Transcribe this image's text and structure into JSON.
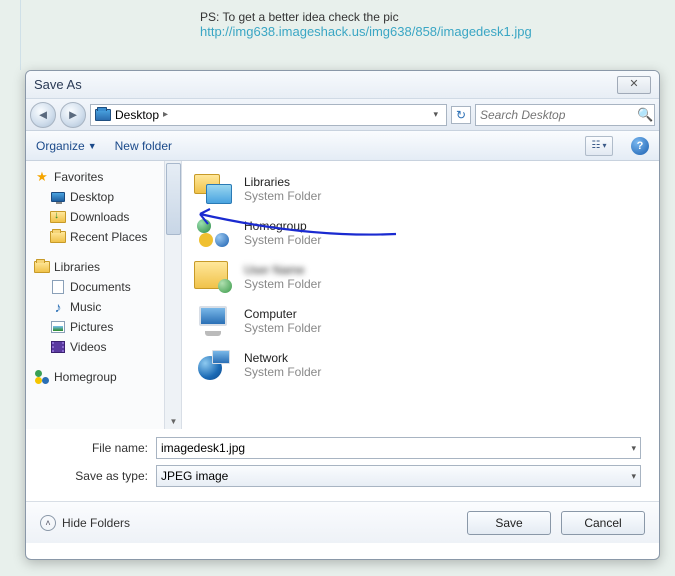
{
  "post": {
    "text": "PS: To get a better idea check the pic",
    "link": "http://img638.imageshack.us/img638/858/imagedesk1.jpg"
  },
  "dialog": {
    "title": "Save As",
    "breadcrumb": {
      "location": "Desktop"
    },
    "search": {
      "placeholder": "Search Desktop"
    },
    "toolbar": {
      "organize": "Organize",
      "new_folder": "New folder"
    },
    "sidebar": {
      "favorites": {
        "label": "Favorites",
        "items": [
          {
            "label": "Desktop"
          },
          {
            "label": "Downloads"
          },
          {
            "label": "Recent Places"
          }
        ]
      },
      "libraries": {
        "label": "Libraries",
        "items": [
          {
            "label": "Documents"
          },
          {
            "label": "Music"
          },
          {
            "label": "Pictures"
          },
          {
            "label": "Videos"
          }
        ]
      },
      "homegroup": {
        "label": "Homegroup"
      }
    },
    "content": {
      "items": [
        {
          "name": "Libraries",
          "sub": "System Folder"
        },
        {
          "name": "Homegroup",
          "sub": "System Folder"
        },
        {
          "name": "blurred",
          "sub": "System Folder"
        },
        {
          "name": "Computer",
          "sub": "System Folder"
        },
        {
          "name": "Network",
          "sub": "System Folder"
        }
      ]
    },
    "fields": {
      "filename_label": "File name:",
      "filename_value": "imagedesk1.jpg",
      "savetype_label": "Save as type:",
      "savetype_value": "JPEG image"
    },
    "footer": {
      "hide_folders": "Hide Folders",
      "save": "Save",
      "cancel": "Cancel"
    }
  }
}
